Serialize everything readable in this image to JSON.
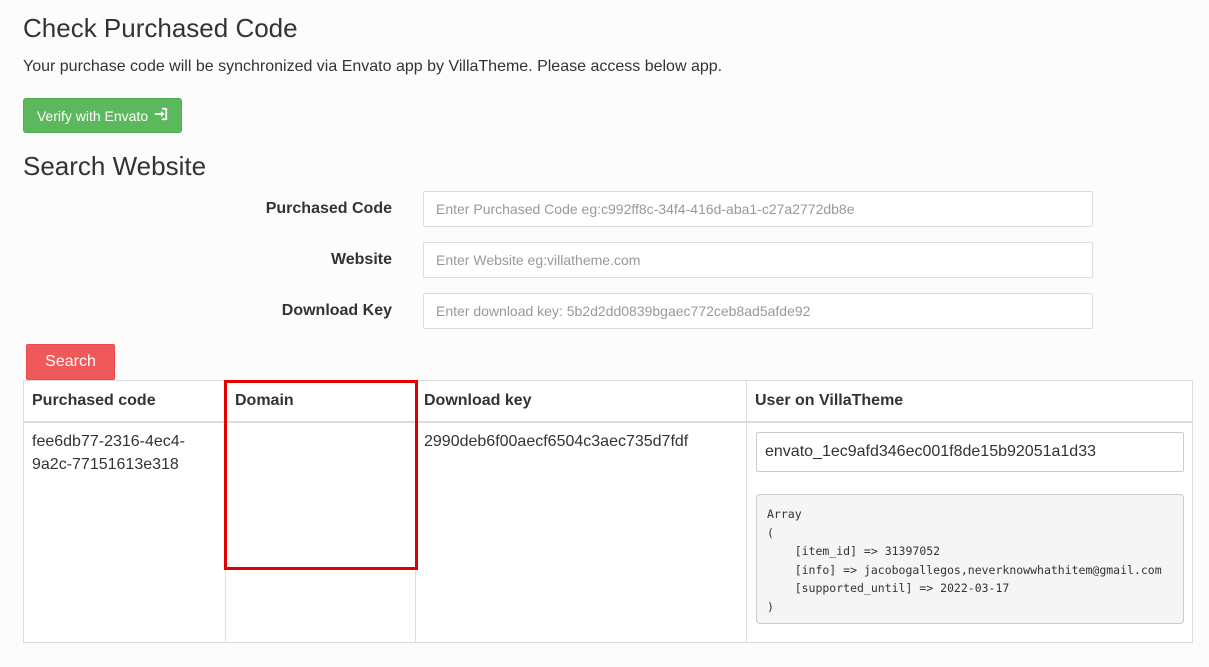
{
  "page": {
    "title": "Check Purchased Code",
    "intro": "Your purchase code will be synchronized via Envato app by VillaTheme. Please access below app.",
    "verify_button": "Verify with Envato"
  },
  "search": {
    "title": "Search Website",
    "fields": [
      {
        "label": "Purchased Code",
        "placeholder": "Enter Purchased Code eg:c992ff8c-34f4-416d-aba1-c27a2772db8e",
        "value": ""
      },
      {
        "label": "Website",
        "placeholder": "Enter Website eg:villatheme.com",
        "value": ""
      },
      {
        "label": "Download Key",
        "placeholder": "Enter download key: 5b2d2dd0839bgaec772ceb8ad5afde92",
        "value": ""
      }
    ],
    "button": "Search"
  },
  "results": {
    "headers": [
      "Purchased code",
      "Domain",
      "Download key",
      "User on VillaTheme"
    ],
    "row": {
      "purchased_code_line1": "fee6db77-2316-4ec4-",
      "purchased_code_line2": "9a2c-77151613e318",
      "domain": "",
      "download_key": "2990deb6f00aecf6504c3aec735d7fdf",
      "user": "envato_1ec9afd346ec001f8de15b92051a1d33",
      "details": "Array\n(\n    [item_id] => 31397052\n    [info] => jacobogallegos,neverknowwhathitem@gmail.com\n    [supported_until] => 2022-03-17\n)"
    }
  },
  "colors": {
    "verify_button": "#5cb85c",
    "search_button": "#f0595a",
    "highlight": "#e20000"
  },
  "icons": {
    "verify_button_icon": "sign-in-icon"
  }
}
